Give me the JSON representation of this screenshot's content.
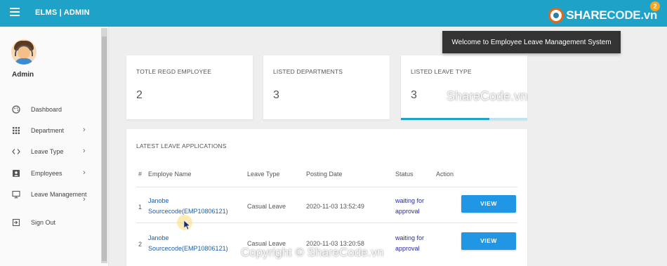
{
  "app": {
    "brand": "ELMS | ADMIN"
  },
  "logo": {
    "part1": "SHARE",
    "part2": "CODE.vn",
    "badge": "2"
  },
  "sidebar": {
    "user_name": "Admin",
    "items": [
      {
        "label": "Dashboard",
        "icon": "palette-icon",
        "has_chevron": false
      },
      {
        "label": "Department",
        "icon": "grid-icon",
        "has_chevron": true
      },
      {
        "label": "Leave Type",
        "icon": "code-icon",
        "has_chevron": true
      },
      {
        "label": "Employees",
        "icon": "account-box-icon",
        "has_chevron": true
      },
      {
        "label": "Leave Management",
        "icon": "monitor-icon",
        "has_chevron": true
      },
      {
        "label": "Sign Out",
        "icon": "exit-icon",
        "has_chevron": false
      }
    ]
  },
  "toast": {
    "message": "Welcome to Employee Leave Management System"
  },
  "stats": [
    {
      "title": "TOTLE REGD EMPLOYEE",
      "value": "2"
    },
    {
      "title": "LISTED DEPARTMENTS",
      "value": "3"
    },
    {
      "title": "LISTED LEAVE TYPE",
      "value": "3",
      "progress": 0.7
    }
  ],
  "leave_table": {
    "title": "LATEST LEAVE APPLICATIONS",
    "headers": [
      "#",
      "Employe Name",
      "Leave Type",
      "Posting Date",
      "Status",
      "Action"
    ],
    "rows": [
      {
        "num": "1",
        "name": "Janobe Sourcecode(EMP10806121)",
        "type": "Casual Leave",
        "date": "2020-11-03 13:52:49",
        "status": "waiting for approval",
        "action": "VIEW"
      },
      {
        "num": "2",
        "name": "Janobe Sourcecode(EMP10806121)",
        "type": "Casual Leave",
        "date": "2020-11-03 13:20:58",
        "status": "waiting for approval",
        "action": "VIEW"
      }
    ]
  },
  "watermarks": {
    "center": "ShareCode.vn",
    "bottom": "Copyright © ShareCode.vn"
  },
  "colors": {
    "topbar": "#1fa2c7",
    "button": "#2196e4",
    "link": "#1d5fa8",
    "status": "#2b2b9e",
    "toast_bg": "#333333"
  }
}
